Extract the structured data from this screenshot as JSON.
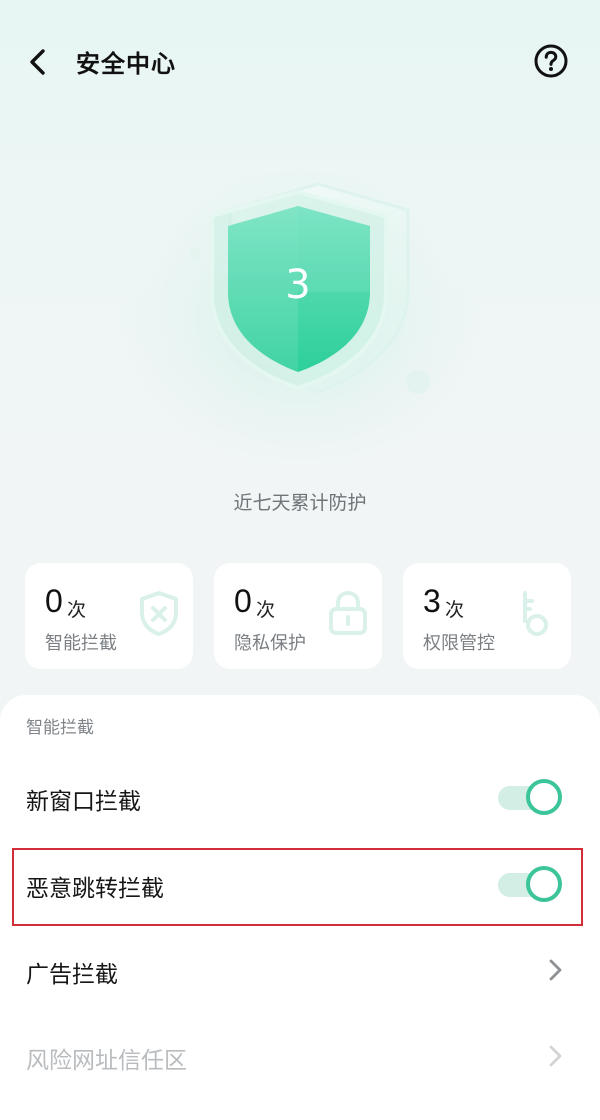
{
  "header": {
    "title": "安全中心",
    "back_icon": "chevron-left-icon",
    "help_icon": "question-circle-icon"
  },
  "hero": {
    "count": "3",
    "caption": "近七天累计防护",
    "shield_icon": "shield-icon"
  },
  "stats": [
    {
      "value": "0",
      "unit": "次",
      "label": "智能拦截",
      "icon": "shield-x-icon"
    },
    {
      "value": "0",
      "unit": "次",
      "label": "隐私保护",
      "icon": "lock-icon"
    },
    {
      "value": "3",
      "unit": "次",
      "label": "权限管控",
      "icon": "key-icon"
    }
  ],
  "settings": {
    "section_title": "智能拦截",
    "rows": [
      {
        "label": "新窗口拦截",
        "control": "toggle",
        "on": true
      },
      {
        "label": "恶意跳转拦截",
        "control": "toggle",
        "on": true
      },
      {
        "label": "广告拦截",
        "control": "chevron",
        "icon": "chevron-right-icon"
      },
      {
        "label": "风险网址信任区",
        "control": "chevron",
        "icon": "chevron-right-icon",
        "disabled": true
      }
    ]
  },
  "colors": {
    "accent": "#3cc59a",
    "toggle_track": "#d3eee5",
    "highlight_border": "#d22d38"
  }
}
